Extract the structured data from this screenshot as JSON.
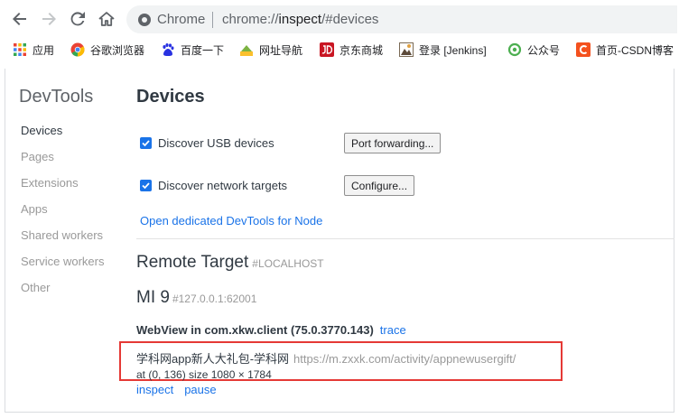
{
  "browser": {
    "site_label": "Chrome",
    "url_prefix": "chrome://",
    "url_host": "inspect",
    "url_path": "/#devices"
  },
  "bookmarks": [
    {
      "label": "应用",
      "icon": "apps-grid-icon"
    },
    {
      "label": "谷歌浏览器",
      "icon": "chrome-logo-icon"
    },
    {
      "label": "百度一下",
      "icon": "baidu-paw-icon"
    },
    {
      "label": "网址导航",
      "icon": "nav-2345-icon"
    },
    {
      "label": "京东商城",
      "icon": "jd-logo-icon"
    },
    {
      "label": "登录 [Jenkins]",
      "icon": "jenkins-icon"
    },
    {
      "label": "公众号",
      "icon": "wechat-icon"
    },
    {
      "label": "首页-CSDN博客",
      "icon": "csdn-icon"
    }
  ],
  "sidebar": {
    "title": "DevTools",
    "items": [
      {
        "label": "Devices",
        "active": true
      },
      {
        "label": "Pages"
      },
      {
        "label": "Extensions"
      },
      {
        "label": "Apps"
      },
      {
        "label": "Shared workers"
      },
      {
        "label": "Service workers"
      },
      {
        "label": "Other"
      }
    ]
  },
  "devices": {
    "title": "Devices",
    "discover_usb": {
      "label": "Discover USB devices",
      "checked": true,
      "button": "Port forwarding..."
    },
    "discover_network": {
      "label": "Discover network targets",
      "checked": true,
      "button": "Configure..."
    },
    "open_node_link": "Open dedicated DevTools for Node"
  },
  "remote": {
    "title": "Remote Target",
    "host": "#LOCALHOST",
    "device": {
      "name": "MI 9",
      "serial": "#127.0.0.1:62001",
      "browser": "WebView in com.xkw.client (75.0.3770.143)",
      "trace_link": "trace",
      "page": {
        "title": "学科网app新人大礼包-学科网",
        "url": "https://m.zxxk.com/activity/appnewusergift/",
        "geometry": "at (0, 136)  size 1080 × 1784"
      },
      "actions": {
        "inspect": "inspect",
        "pause": "pause"
      }
    }
  },
  "colors": {
    "accent": "#1a73e8",
    "highlight": "#e53935",
    "muted": "#999999"
  }
}
